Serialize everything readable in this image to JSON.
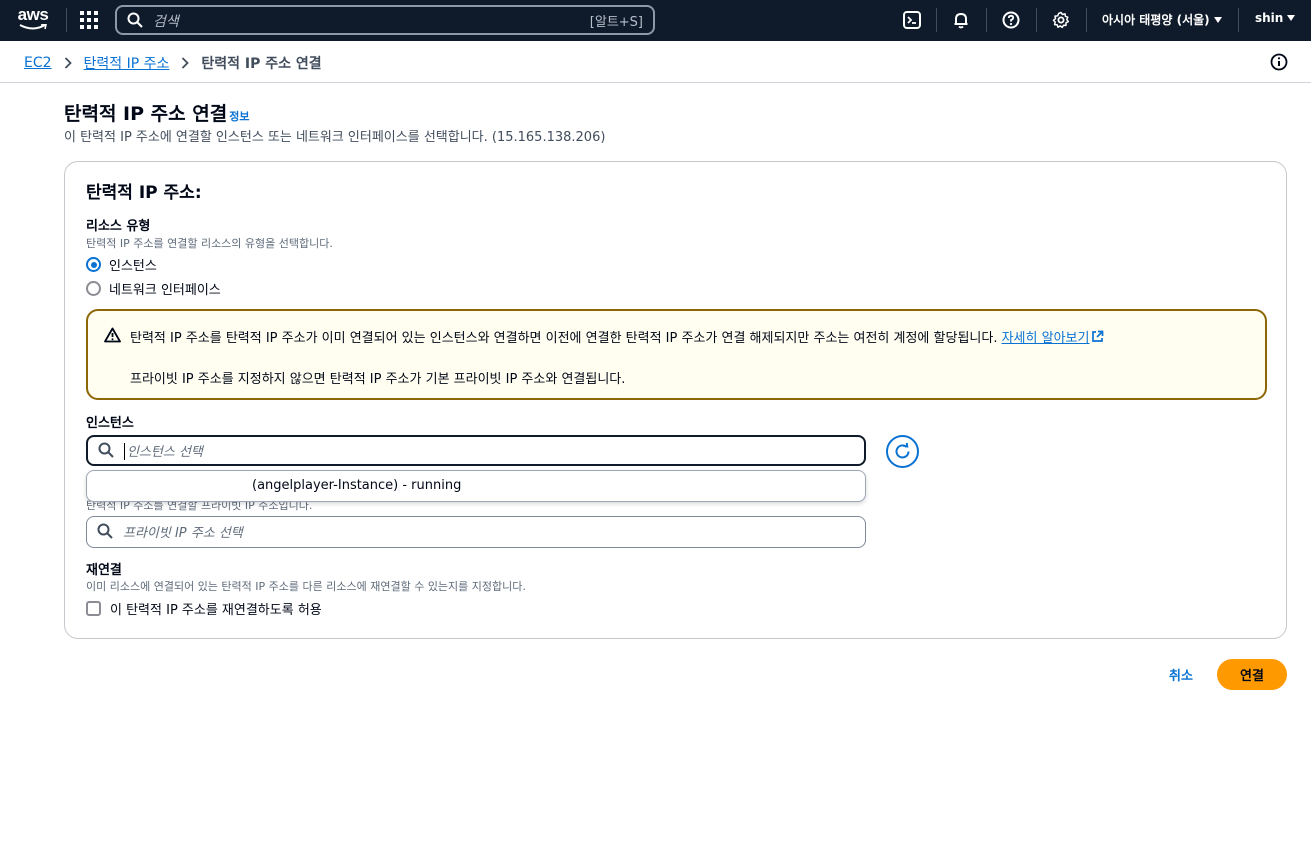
{
  "topnav": {
    "logo_text": "aws",
    "search_placeholder": "검색",
    "search_shortcut": "[알트+S]",
    "region": "아시아 태평양 (서울)",
    "user": "shin",
    "icons": [
      "services-grid-icon",
      "search-icon",
      "cloudshell-icon",
      "bell-icon",
      "help-icon",
      "settings-icon"
    ]
  },
  "breadcrumb": {
    "items": [
      "EC2",
      "탄력적 IP 주소"
    ],
    "current": "탄력적 IP 주소 연결"
  },
  "header": {
    "title": "탄력적 IP 주소 연결",
    "info_link": "정보",
    "description": "이 탄력적 IP 주소에 연결할 인스턴스 또는 네트워크 인터페이스를 선택합니다. (15.165.138.206)"
  },
  "form": {
    "title": "탄력적 IP 주소:",
    "resource_type": {
      "label": "리소스 유형",
      "description": "탄력적 IP 주소를 연결할 리소스의 유형을 선택합니다.",
      "options": [
        "인스턴스",
        "네트워크 인터페이스"
      ],
      "selected": "인스턴스"
    },
    "alert": {
      "line1": "탄력적 IP 주소를 탄력적 IP 주소가 이미 연결되어 있는 인스턴스와 연결하면 이전에 연결한 탄력적 IP 주소가 연결 해제되지만 주소는 여전히 계정에 할당됩니다.",
      "link": "자세히 알아보기",
      "line2": "프라이빗 IP 주소를 지정하지 않으면 탄력적 IP 주소가 기본 프라이빗 IP 주소와 연결됩니다."
    },
    "instance": {
      "label": "인스턴스",
      "placeholder": "인스턴스 선택",
      "dropdown_option": "(angelplayer-Instance) - running"
    },
    "private_ip": {
      "description": "탄력적 IP 주소를 연결할 프라이빗 IP 주소입니다.",
      "placeholder": "프라이빗 IP 주소 선택"
    },
    "reassociation": {
      "label": "재연결",
      "description": "이미 리소스에 연결되어 있는 탄력적 IP 주소를 다른 리소스에 재연결할 수 있는지를 지정합니다.",
      "checkbox_label": "이 탄력적 IP 주소를 재연결하도록 허용",
      "checked": false
    }
  },
  "actions": {
    "cancel": "취소",
    "connect": "연결"
  },
  "colors": {
    "nav_bg": "#0f1b2a",
    "link": "#0972d3",
    "primary_button": "#ff9900",
    "warning_border": "#8d6605",
    "warning_bg": "#fffef0"
  }
}
